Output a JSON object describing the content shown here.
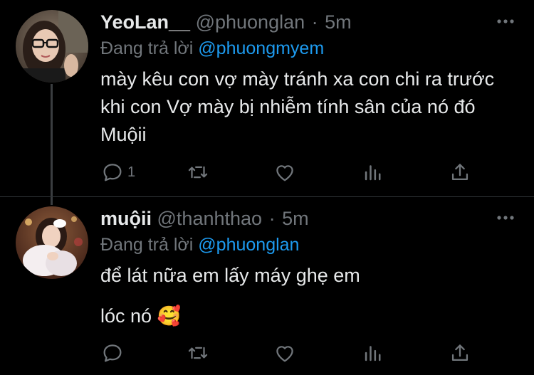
{
  "colors": {
    "background": "#000000",
    "text": "#e7e9ea",
    "muted": "#71767b",
    "accent": "#1d9bf0",
    "divider": "#2f3336"
  },
  "tweets": [
    {
      "display_name": "YeoLan__",
      "handle": "@phuonglan",
      "separator": "·",
      "time": "5m",
      "reply_label": "Đang trả lời",
      "reply_to": "@phuongmyem",
      "text": "mày kêu con vợ mày tránh xa con chi ra trước khi con Vợ mày bị nhiễm tính sân của nó đó Muộii",
      "actions": {
        "reply_count": "1",
        "reply_icon": "comment-icon",
        "retweet_icon": "retweet-icon",
        "like_icon": "heart-icon",
        "views_icon": "analytics-icon",
        "share_icon": "share-icon"
      }
    },
    {
      "display_name": "muộii",
      "handle": "@thanhthao",
      "separator": "·",
      "time": "5m",
      "reply_label": "Đang trả lời",
      "reply_to": "@phuonglan",
      "text_line1": "để lát nữa em lấy máy ghẹ em",
      "text_line2": "lóc nó 🥰",
      "actions": {
        "reply_count": "",
        "reply_icon": "comment-icon",
        "retweet_icon": "retweet-icon",
        "like_icon": "heart-icon",
        "views_icon": "analytics-icon",
        "share_icon": "share-icon"
      }
    }
  ]
}
